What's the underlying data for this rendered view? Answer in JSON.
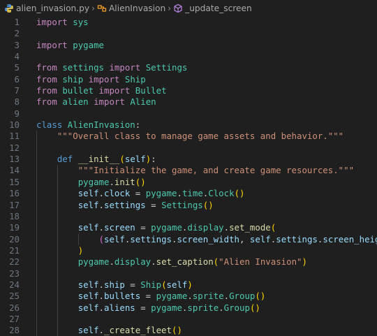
{
  "breadcrumb": {
    "file": {
      "label": "alien_invasion.py",
      "icon": "python-file-icon"
    },
    "class": {
      "label": "AlienInvasion",
      "icon": "class-icon"
    },
    "method": {
      "label": "_update_screen",
      "icon": "method-icon"
    }
  },
  "colors": {
    "background": "#1f1f1f",
    "keyword": "#569cd6",
    "control_keyword": "#c586c0",
    "class_name": "#4ec9b0",
    "function": "#dcdcaa",
    "string": "#ce9178",
    "variable": "#9cdcfe",
    "bracket_1": "#ffd700",
    "bracket_2": "#da70d6",
    "bracket_3": "#179fff",
    "line_number": "#6e7681"
  },
  "editor": {
    "lines": [
      {
        "n": "1",
        "indent": 0,
        "tokens": [
          [
            "import",
            "ctl"
          ],
          [
            " ",
            "plain"
          ],
          [
            "sys",
            "cls"
          ]
        ]
      },
      {
        "n": "2",
        "indent": 0,
        "tokens": []
      },
      {
        "n": "3",
        "indent": 0,
        "tokens": [
          [
            "import",
            "ctl"
          ],
          [
            " ",
            "plain"
          ],
          [
            "pygame",
            "cls"
          ]
        ]
      },
      {
        "n": "4",
        "indent": 0,
        "tokens": []
      },
      {
        "n": "5",
        "indent": 0,
        "tokens": [
          [
            "from",
            "ctl"
          ],
          [
            " ",
            "plain"
          ],
          [
            "settings",
            "cls"
          ],
          [
            " ",
            "plain"
          ],
          [
            "import",
            "ctl"
          ],
          [
            " ",
            "plain"
          ],
          [
            "Settings",
            "cls"
          ]
        ]
      },
      {
        "n": "6",
        "indent": 0,
        "tokens": [
          [
            "from",
            "ctl"
          ],
          [
            " ",
            "plain"
          ],
          [
            "ship",
            "cls"
          ],
          [
            " ",
            "plain"
          ],
          [
            "import",
            "ctl"
          ],
          [
            " ",
            "plain"
          ],
          [
            "Ship",
            "cls"
          ]
        ]
      },
      {
        "n": "7",
        "indent": 0,
        "tokens": [
          [
            "from",
            "ctl"
          ],
          [
            " ",
            "plain"
          ],
          [
            "bullet",
            "cls"
          ],
          [
            " ",
            "plain"
          ],
          [
            "import",
            "ctl"
          ],
          [
            " ",
            "plain"
          ],
          [
            "Bullet",
            "cls"
          ]
        ]
      },
      {
        "n": "8",
        "indent": 0,
        "tokens": [
          [
            "from",
            "ctl"
          ],
          [
            " ",
            "plain"
          ],
          [
            "alien",
            "cls"
          ],
          [
            " ",
            "plain"
          ],
          [
            "import",
            "ctl"
          ],
          [
            " ",
            "plain"
          ],
          [
            "Alien",
            "cls"
          ]
        ]
      },
      {
        "n": "9",
        "indent": 0,
        "tokens": []
      },
      {
        "n": "10",
        "indent": 0,
        "tokens": [
          [
            "class",
            "kw"
          ],
          [
            " ",
            "plain"
          ],
          [
            "AlienInvasion",
            "cls"
          ],
          [
            ":",
            "plain"
          ]
        ]
      },
      {
        "n": "11",
        "indent": 1,
        "tokens": [
          [
            "    ",
            "plain"
          ],
          [
            "\"\"\"Overall class to manage game assets and behavior.\"\"\"",
            "str"
          ]
        ]
      },
      {
        "n": "12",
        "indent": 1,
        "tokens": []
      },
      {
        "n": "13",
        "indent": 1,
        "tokens": [
          [
            "    ",
            "plain"
          ],
          [
            "def",
            "kw"
          ],
          [
            " ",
            "plain"
          ],
          [
            "__init__",
            "fn"
          ],
          [
            "(",
            "p1"
          ],
          [
            "self",
            "self"
          ],
          [
            ")",
            "p1"
          ],
          [
            ":",
            "plain"
          ]
        ]
      },
      {
        "n": "14",
        "indent": 2,
        "tokens": [
          [
            "        ",
            "plain"
          ],
          [
            "\"\"\"Initialize the game, and create game resources.\"\"\"",
            "str"
          ]
        ]
      },
      {
        "n": "15",
        "indent": 2,
        "tokens": [
          [
            "        ",
            "plain"
          ],
          [
            "pygame",
            "cls"
          ],
          [
            ".",
            "plain"
          ],
          [
            "init",
            "fn"
          ],
          [
            "()",
            "p1"
          ]
        ]
      },
      {
        "n": "16",
        "indent": 2,
        "tokens": [
          [
            "        ",
            "plain"
          ],
          [
            "self",
            "self"
          ],
          [
            ".",
            "plain"
          ],
          [
            "clock",
            "var"
          ],
          [
            " = ",
            "plain"
          ],
          [
            "pygame",
            "cls"
          ],
          [
            ".",
            "plain"
          ],
          [
            "time",
            "cls"
          ],
          [
            ".",
            "plain"
          ],
          [
            "Clock",
            "cls"
          ],
          [
            "()",
            "p1"
          ]
        ]
      },
      {
        "n": "17",
        "indent": 2,
        "tokens": [
          [
            "        ",
            "plain"
          ],
          [
            "self",
            "self"
          ],
          [
            ".",
            "plain"
          ],
          [
            "settings",
            "var"
          ],
          [
            " = ",
            "plain"
          ],
          [
            "Settings",
            "cls"
          ],
          [
            "()",
            "p1"
          ]
        ]
      },
      {
        "n": "18",
        "indent": 2,
        "tokens": []
      },
      {
        "n": "19",
        "indent": 2,
        "tokens": [
          [
            "        ",
            "plain"
          ],
          [
            "self",
            "self"
          ],
          [
            ".",
            "plain"
          ],
          [
            "screen",
            "var"
          ],
          [
            " = ",
            "plain"
          ],
          [
            "pygame",
            "cls"
          ],
          [
            ".",
            "plain"
          ],
          [
            "display",
            "cls"
          ],
          [
            ".",
            "plain"
          ],
          [
            "set_mode",
            "fn"
          ],
          [
            "(",
            "p1"
          ]
        ]
      },
      {
        "n": "20",
        "indent": 3,
        "tokens": [
          [
            "            ",
            "plain"
          ],
          [
            "(",
            "p2"
          ],
          [
            "self",
            "self"
          ],
          [
            ".",
            "plain"
          ],
          [
            "settings",
            "var"
          ],
          [
            ".",
            "plain"
          ],
          [
            "screen_width",
            "var"
          ],
          [
            ", ",
            "plain"
          ],
          [
            "self",
            "self"
          ],
          [
            ".",
            "plain"
          ],
          [
            "settings",
            "var"
          ],
          [
            ".",
            "plain"
          ],
          [
            "screen_height",
            "var"
          ],
          [
            ")",
            "p2"
          ]
        ]
      },
      {
        "n": "21",
        "indent": 2,
        "tokens": [
          [
            "        ",
            "plain"
          ],
          [
            ")",
            "p1"
          ]
        ]
      },
      {
        "n": "22",
        "indent": 2,
        "tokens": [
          [
            "        ",
            "plain"
          ],
          [
            "pygame",
            "cls"
          ],
          [
            ".",
            "plain"
          ],
          [
            "display",
            "cls"
          ],
          [
            ".",
            "plain"
          ],
          [
            "set_caption",
            "fn"
          ],
          [
            "(",
            "p1"
          ],
          [
            "\"Alien Invasion\"",
            "str"
          ],
          [
            ")",
            "p1"
          ]
        ]
      },
      {
        "n": "23",
        "indent": 2,
        "tokens": []
      },
      {
        "n": "24",
        "indent": 2,
        "tokens": [
          [
            "        ",
            "plain"
          ],
          [
            "self",
            "self"
          ],
          [
            ".",
            "plain"
          ],
          [
            "ship",
            "var"
          ],
          [
            " = ",
            "plain"
          ],
          [
            "Ship",
            "cls"
          ],
          [
            "(",
            "p1"
          ],
          [
            "self",
            "self"
          ],
          [
            ")",
            "p1"
          ]
        ]
      },
      {
        "n": "25",
        "indent": 2,
        "tokens": [
          [
            "        ",
            "plain"
          ],
          [
            "self",
            "self"
          ],
          [
            ".",
            "plain"
          ],
          [
            "bullets",
            "var"
          ],
          [
            " = ",
            "plain"
          ],
          [
            "pygame",
            "cls"
          ],
          [
            ".",
            "plain"
          ],
          [
            "sprite",
            "cls"
          ],
          [
            ".",
            "plain"
          ],
          [
            "Group",
            "cls"
          ],
          [
            "()",
            "p1"
          ]
        ]
      },
      {
        "n": "26",
        "indent": 2,
        "tokens": [
          [
            "        ",
            "plain"
          ],
          [
            "self",
            "self"
          ],
          [
            ".",
            "plain"
          ],
          [
            "aliens",
            "var"
          ],
          [
            " = ",
            "plain"
          ],
          [
            "pygame",
            "cls"
          ],
          [
            ".",
            "plain"
          ],
          [
            "sprite",
            "cls"
          ],
          [
            ".",
            "plain"
          ],
          [
            "Group",
            "cls"
          ],
          [
            "()",
            "p1"
          ]
        ]
      },
      {
        "n": "27",
        "indent": 2,
        "tokens": []
      },
      {
        "n": "28",
        "indent": 2,
        "tokens": [
          [
            "        ",
            "plain"
          ],
          [
            "self",
            "self"
          ],
          [
            ".",
            "plain"
          ],
          [
            "_create_fleet",
            "fn"
          ],
          [
            "()",
            "p1"
          ]
        ]
      }
    ]
  }
}
